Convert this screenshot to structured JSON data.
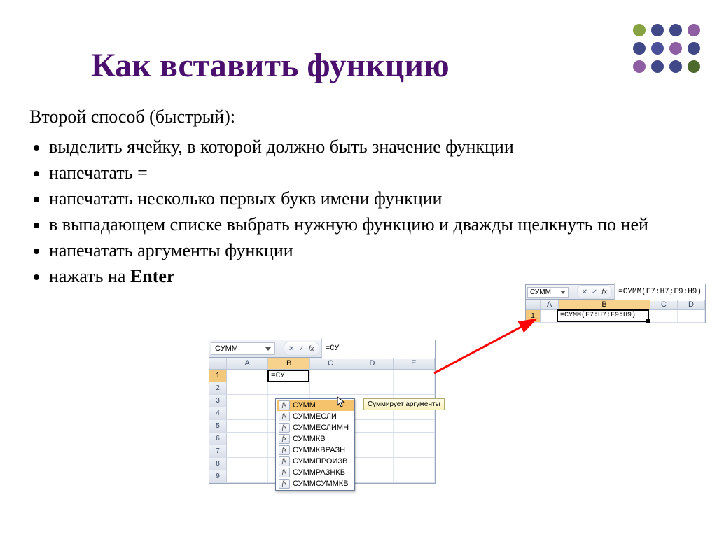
{
  "title": "Как вставить функцию",
  "intro": "Второй способ (быстрый):",
  "bullets": [
    "выделить ячейку, в которой должно быть значение функции",
    "напечатать =",
    "напечатать несколько первых букв имени функции",
    "в выпадающем списке выбрать нужную функцию и дважды щелкнуть по ней",
    "напечатать аргументы функции"
  ],
  "last_bullet_prefix": "нажать на ",
  "last_bullet_key": "Enter",
  "excel1": {
    "name_box": "СУММ",
    "fbar_x": "✕",
    "fbar_v": "✓",
    "fbar_fx": "fx",
    "formula_text": "=СУ",
    "cols": [
      "A",
      "B",
      "C",
      "D",
      "E"
    ],
    "row_nums": [
      1,
      2,
      3,
      4,
      5,
      6,
      7,
      8,
      9
    ],
    "active_cell_text": "=СУ",
    "tooltip": "Суммирует аргументы",
    "suggestions": [
      {
        "label": "СУММ",
        "selected": true
      },
      {
        "label": "СУММЕСЛИ",
        "selected": false
      },
      {
        "label": "СУММЕСЛИМН",
        "selected": false
      },
      {
        "label": "СУММКВ",
        "selected": false
      },
      {
        "label": "СУММКВРАЗН",
        "selected": false
      },
      {
        "label": "СУММПРОИЗВ",
        "selected": false
      },
      {
        "label": "СУММРАЗНКВ",
        "selected": false
      },
      {
        "label": "СУММСУММКВ",
        "selected": false
      }
    ]
  },
  "excel2": {
    "name_box": "СУММ",
    "fbar_x": "✕",
    "fbar_v": "✓",
    "fbar_fx": "fx",
    "formula_text": "=СУММ(F7:H7;F9:H9)",
    "cols": [
      "A",
      "B",
      "C",
      "D"
    ],
    "row_nums": [
      1
    ],
    "active_cell_text": "=СУММ(F7:H7;F9:H9)"
  }
}
